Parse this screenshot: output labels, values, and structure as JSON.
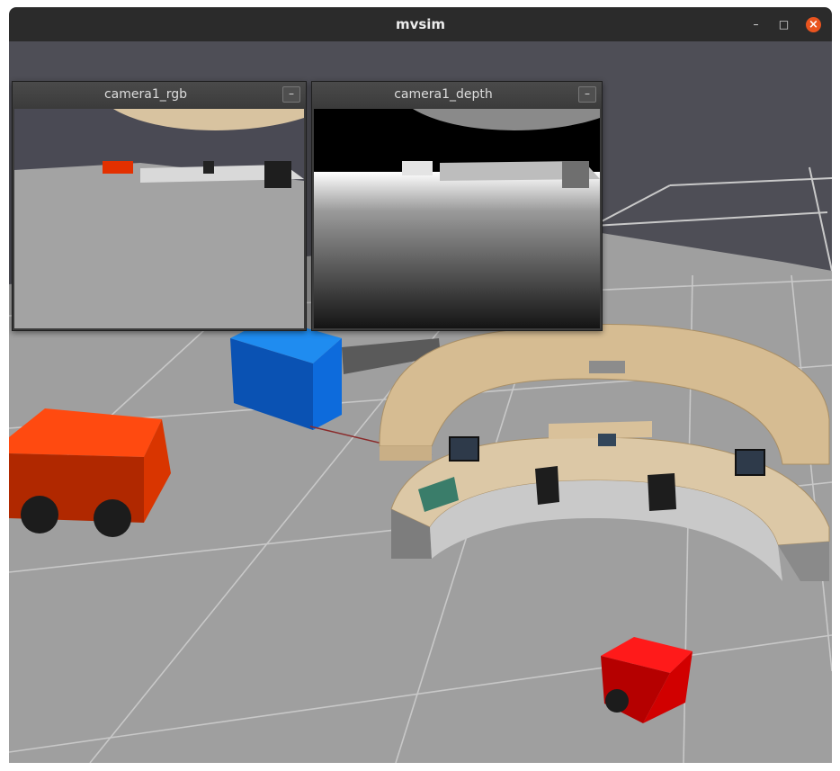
{
  "window": {
    "title": "mvsim",
    "minimize_glyph": "–",
    "maximize_glyph": "□",
    "close_glyph": "×"
  },
  "panels": [
    {
      "title": "camera1_rgb",
      "minimize_glyph": "–"
    },
    {
      "title": "camera1_depth",
      "minimize_glyph": "–"
    }
  ],
  "colors": {
    "floor": "#9e9e9e",
    "grid_line": "#c4c4c4",
    "dark_floor": "#52525a",
    "blue_box": "#0a66d6",
    "red_vehicle": "#e63300",
    "small_robot": "#e10000",
    "desk_wood": "#d9c09a",
    "close_button": "#e9541f"
  },
  "icons": [
    "minimize-icon",
    "maximize-icon",
    "close-icon"
  ]
}
